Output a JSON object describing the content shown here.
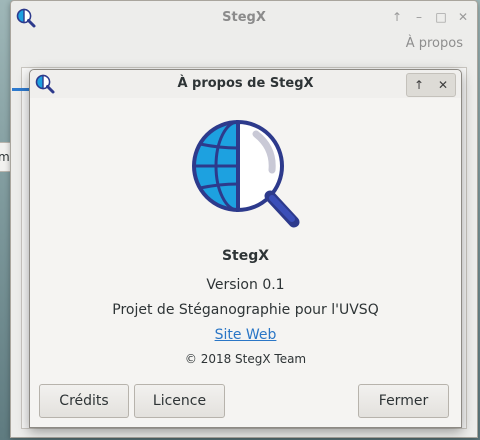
{
  "main_window": {
    "title": "StegX",
    "menu_apropos": "À propos"
  },
  "desktop": {
    "partial_text": "m"
  },
  "dialog": {
    "title": "À propos de StegX",
    "app_name": "StegX",
    "version": "Version 0.1",
    "description": "Projet de Stéganographie pour l'UVSQ",
    "website_label": "Site Web",
    "copyright": "© 2018 StegX Team",
    "buttons": {
      "credits": "Crédits",
      "licence": "Licence",
      "fermer": "Fermer"
    }
  },
  "colors": {
    "accent": "#2a76c6",
    "logo_globe": "#1da1e0",
    "logo_outline": "#2d3a8c"
  }
}
